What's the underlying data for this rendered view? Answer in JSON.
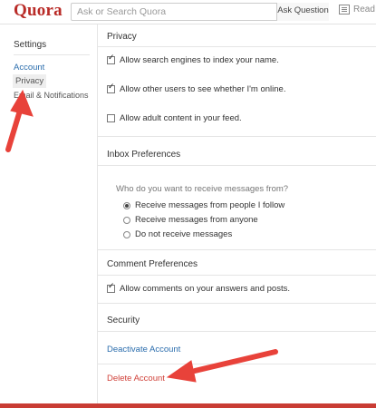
{
  "header": {
    "logo": "Quora",
    "search_placeholder": "Ask or Search Quora",
    "ask_button": "Ask Question",
    "read_label": "Read"
  },
  "sidebar": {
    "title": "Settings",
    "items": [
      {
        "label": "Account"
      },
      {
        "label": "Privacy"
      },
      {
        "label": "Email & Notifications"
      }
    ]
  },
  "privacy": {
    "title": "Privacy",
    "options": [
      {
        "label": "Allow search engines to index your name.",
        "checked": true
      },
      {
        "label": "Allow other users to see whether I'm online.",
        "checked": true
      },
      {
        "label": "Allow adult content in your feed.",
        "checked": false
      }
    ]
  },
  "inbox": {
    "title": "Inbox Preferences",
    "question": "Who do you want to receive messages from?",
    "options": [
      {
        "label": "Receive messages from people I follow",
        "selected": true
      },
      {
        "label": "Receive messages from anyone",
        "selected": false
      },
      {
        "label": "Do not receive messages",
        "selected": false
      }
    ]
  },
  "comments": {
    "title": "Comment Preferences",
    "option": {
      "label": "Allow comments on your answers and posts.",
      "checked": true
    }
  },
  "security": {
    "title": "Security",
    "deactivate": "Deactivate Account",
    "delete": "Delete Account"
  },
  "colors": {
    "brand": "#b92b27",
    "link": "#2b6dad",
    "danger": "#d0423a",
    "arrow": "#e8423a"
  }
}
